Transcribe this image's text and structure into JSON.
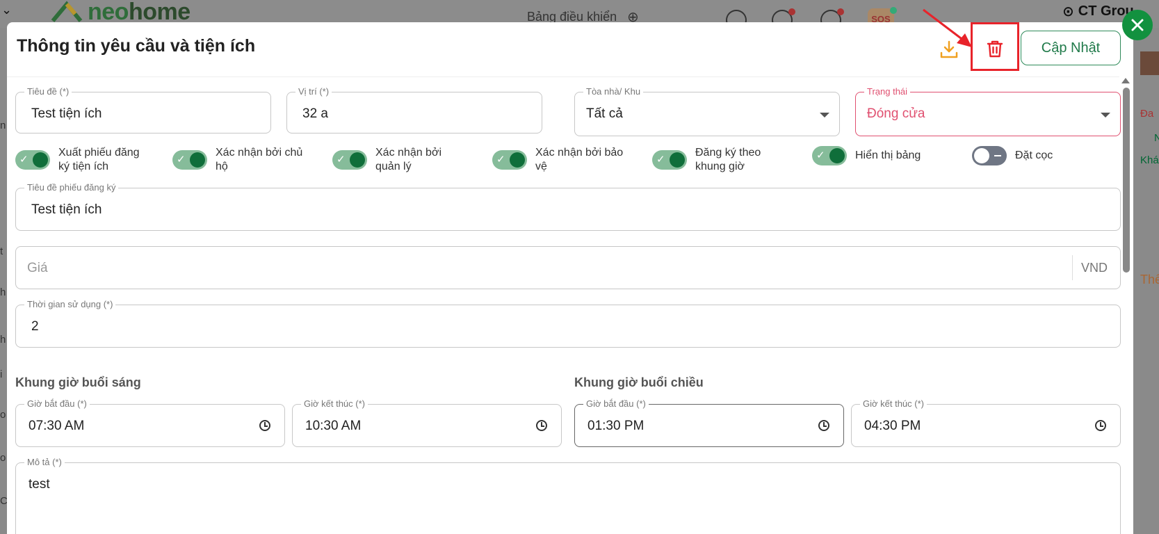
{
  "background": {
    "brand_neo": "neo",
    "brand_home": "home",
    "dashboard_label": "Bảng điều khiển",
    "sos_label": "SOS",
    "company_name": "CT Grou",
    "edge_left": [
      "n",
      "t",
      "h",
      "h",
      "i",
      "o",
      "o",
      "C"
    ],
    "edge_right": [
      "Đa",
      "N",
      "Khá",
      "Thế"
    ]
  },
  "modal": {
    "title": "Thông tin yêu cầu và tiện ích",
    "update_label": "Cập Nhật",
    "fields": {
      "title": {
        "label": "Tiêu đề (*)",
        "value": "Test tiện ích"
      },
      "location": {
        "label": "Vị trí (*)",
        "value": "32 a"
      },
      "building": {
        "label": "Tòa nhà/ Khu",
        "value": "Tất cả"
      },
      "status": {
        "label": "Trạng thái",
        "value": "Đóng cửa"
      },
      "form_title": {
        "label": "Tiêu đề phiếu đăng ký",
        "value": "Test tiện ích"
      },
      "price": {
        "placeholder": "Giá",
        "suffix": "VND"
      },
      "duration": {
        "label": "Thời gian sử dụng (*)",
        "value": "2"
      },
      "description": {
        "label": "Mô tả (*)",
        "value": "test"
      }
    },
    "toggles": [
      {
        "label": "Xuất phiếu đăng ký tiện ích",
        "on": true
      },
      {
        "label": "Xác nhận bởi chủ hộ",
        "on": true
      },
      {
        "label": "Xác nhận bởi quản lý",
        "on": true
      },
      {
        "label": "Xác nhận bởi bảo vệ",
        "on": true
      },
      {
        "label": "Đăng ký theo khung giờ",
        "on": true
      },
      {
        "label": "Hiển thị bảng",
        "on": true
      },
      {
        "label": "Đặt cọc",
        "on": false
      }
    ],
    "morning": {
      "title": "Khung giờ buổi sáng",
      "start": {
        "label": "Giờ bắt đầu (*)",
        "value": "07:30 AM"
      },
      "end": {
        "label": "Giờ kết thúc (*)",
        "value": "10:30 AM"
      }
    },
    "afternoon": {
      "title": "Khung giờ buổi chiều",
      "start": {
        "label": "Giờ bắt đầu (*)",
        "value": "01:30 PM"
      },
      "end": {
        "label": "Giờ kết thúc (*)",
        "value": "04:30 PM"
      }
    }
  },
  "colors": {
    "accent_green": "#12913f",
    "status_red": "#e05070",
    "download_orange": "#f0a020",
    "delete_red": "#e8232a"
  }
}
